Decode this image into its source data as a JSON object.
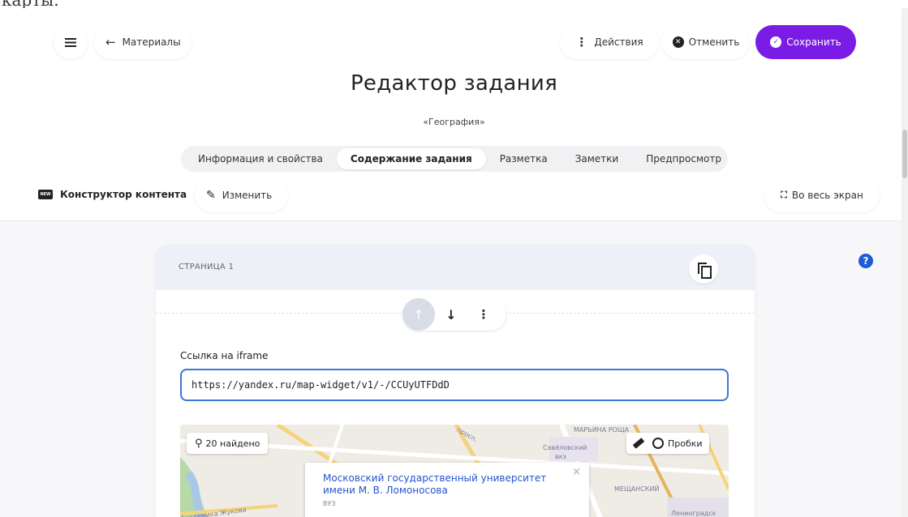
{
  "top_cut_text": "карты.",
  "header": {
    "back_label": "Материалы",
    "actions_label": "Действия",
    "cancel_label": "Отменить",
    "save_label": "Сохранить",
    "accent_color": "#7a1ce6"
  },
  "title": "Редактор задания",
  "subtitle": "«География»",
  "tabs": [
    {
      "label": "Информация и свойства",
      "active": false
    },
    {
      "label": "Содержание задания",
      "active": true
    },
    {
      "label": "Разметка",
      "active": false
    },
    {
      "label": "Заметки",
      "active": false
    },
    {
      "label": "Предпросмотр",
      "active": false
    }
  ],
  "toolbar": {
    "badge": "NEW",
    "constructor_label": "Конструктор контента",
    "edit_label": "Изменить",
    "fullscreen_label": "Во весь экран"
  },
  "help_glyph": "?",
  "card": {
    "page_label": "СТРАНИЦА 1",
    "field_label": "Ссылка на iframe",
    "iframe_value": "https://yandex.ru/map-widget/v1/-/CCUyUTFDdD"
  },
  "map": {
    "search_label": "20 найдено",
    "traffic_label": "Пробки",
    "labels": {
      "marina": "МАРЬИНА РОЩА",
      "savelovsky": "Савёловский",
      "vokzal": "вкз",
      "meshchansky": "МЕЩАНСКИЙ",
      "leningradsky": "Ленинградск",
      "prospect": "просп.",
      "street": "Академика Жукова"
    },
    "popup": {
      "title": "Московский государственный университет имени М. В. Ломоносова",
      "subtitle": "ВУЗ"
    }
  }
}
